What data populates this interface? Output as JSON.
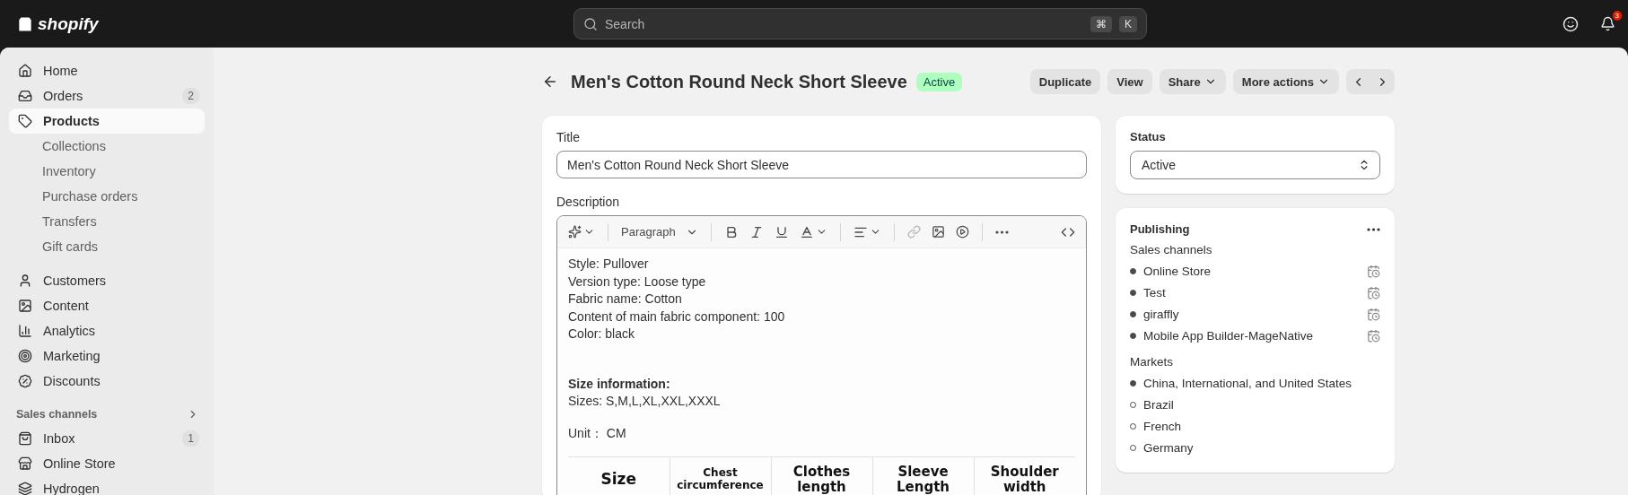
{
  "top_bar": {
    "logo": "shopify",
    "search": {
      "placeholder": "Search"
    },
    "shortcut_keys": [
      "⌘",
      "K"
    ],
    "notification_count": "3"
  },
  "sidebar": {
    "items": [
      {
        "label": "Home",
        "selected": false
      },
      {
        "label": "Orders",
        "selected": false,
        "badge": "2"
      },
      {
        "label": "Products",
        "selected": true,
        "children": [
          {
            "label": "Collections",
            "selected": false
          },
          {
            "label": "Inventory",
            "selected": false
          },
          {
            "label": "Purchase orders",
            "selected": false
          },
          {
            "label": "Transfers",
            "selected": false
          },
          {
            "label": "Gift cards",
            "selected": false
          }
        ]
      },
      {
        "label": "Customers",
        "selected": false
      },
      {
        "label": "Content",
        "selected": false
      },
      {
        "label": "Analytics",
        "selected": false
      },
      {
        "label": "Marketing",
        "selected": false
      },
      {
        "label": "Discounts",
        "selected": false
      }
    ],
    "section_title": "Sales channels",
    "channels": [
      {
        "label": "Inbox",
        "selected": false,
        "badge": "1"
      },
      {
        "label": "Online Store",
        "selected": false
      },
      {
        "label": "Hydrogen",
        "selected": false
      }
    ]
  },
  "header": {
    "title": "Men's Cotton Round Neck Short Sleeve",
    "status": "Active",
    "actions": [
      {
        "label": "Duplicate",
        "dropdown": false
      },
      {
        "label": "View",
        "dropdown": false
      },
      {
        "label": "Share",
        "dropdown": true
      },
      {
        "label": "More actions",
        "dropdown": true
      }
    ]
  },
  "product": {
    "title_label": "Title",
    "title_value": "Men's Cotton Round Neck Short Sleeve",
    "description_label": "Description",
    "toolbar": {
      "paragraph_style": "Paragraph"
    },
    "description": [
      {
        "kind": "lines",
        "lines": [
          "Style: Pullover",
          "Version type: Loose type",
          "Fabric name: Cotton",
          "Content of main fabric component: 100",
          "Color: black"
        ]
      },
      {
        "kind": "heading",
        "lines": [
          "Size information:"
        ]
      },
      {
        "kind": "lines",
        "lines": [
          "Sizes: S,M,L,XL,XXL,XXXL"
        ]
      },
      {
        "kind": "lines",
        "lines": [
          "Unit： CM"
        ]
      }
    ],
    "size_table": {
      "columns": [
        "Size",
        "Chest circumference",
        "Clothes length",
        "Sleeve Length",
        "Shoulder width"
      ]
    }
  },
  "status_card": {
    "label": "Status",
    "value": "Active"
  },
  "publishing": {
    "title": "Publishing",
    "channels_label": "Sales channels",
    "channels": [
      {
        "name": "Online Store",
        "published": true
      },
      {
        "name": "Test",
        "published": true
      },
      {
        "name": "giraffly",
        "published": true
      },
      {
        "name": "Mobile App Builder-MageNative",
        "published": true
      }
    ],
    "markets_label": "Markets",
    "markets": [
      {
        "name": "China, International, and United States",
        "published": true
      },
      {
        "name": "Brazil",
        "published": false
      },
      {
        "name": "French",
        "published": false
      },
      {
        "name": "Germany",
        "published": false
      }
    ]
  }
}
